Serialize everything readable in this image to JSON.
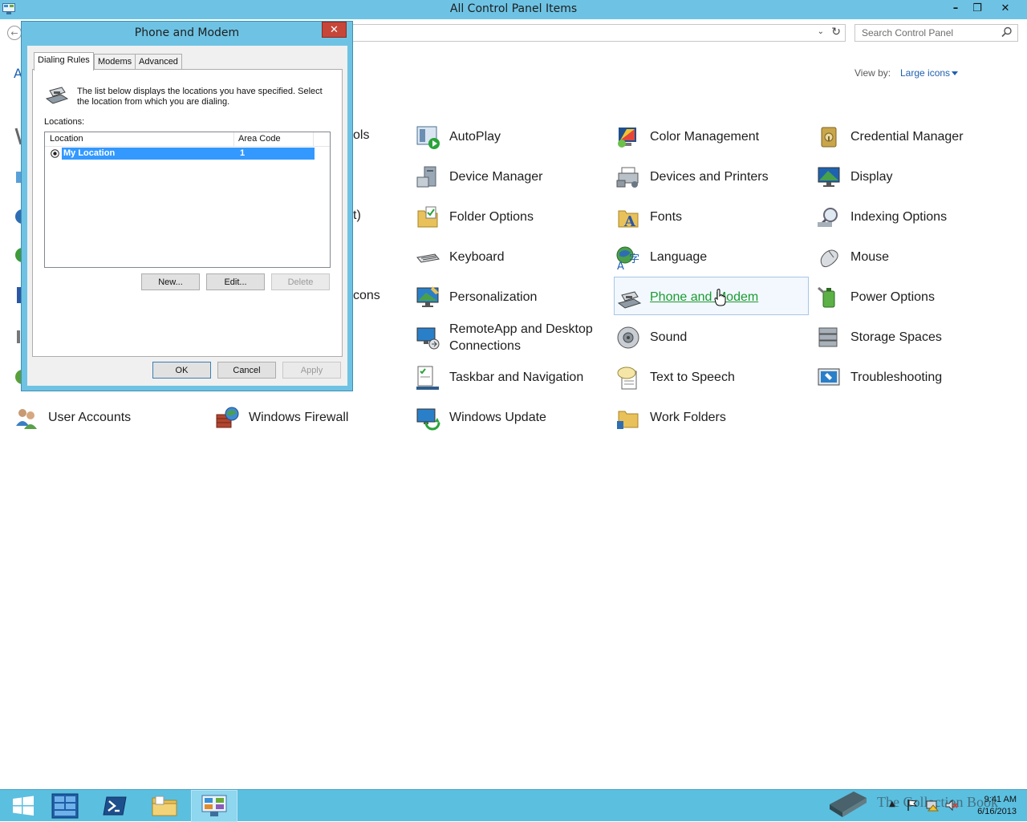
{
  "window": {
    "title": "All Control Panel Items",
    "minimize": "–",
    "restore": "❐",
    "close": "✕"
  },
  "address": {
    "search_placeholder": "Search Control Panel"
  },
  "view_by": {
    "label": "View by:",
    "value": "Large icons"
  },
  "heading_stub": "A",
  "partial_labels": {
    "row1": "ols",
    "row3": "t)",
    "row5": "cons"
  },
  "items": [
    {
      "label": "AutoPlay",
      "icon": "autoplay-icon"
    },
    {
      "label": "Color Management",
      "icon": "color-management-icon"
    },
    {
      "label": "Credential Manager",
      "icon": "credential-manager-icon"
    },
    {
      "label": "Device Manager",
      "icon": "device-manager-icon"
    },
    {
      "label": "Devices and Printers",
      "icon": "devices-printers-icon"
    },
    {
      "label": "Display",
      "icon": "display-icon"
    },
    {
      "label": "Folder Options",
      "icon": "folder-options-icon"
    },
    {
      "label": "Fonts",
      "icon": "fonts-icon"
    },
    {
      "label": "Indexing Options",
      "icon": "indexing-options-icon"
    },
    {
      "label": "Keyboard",
      "icon": "keyboard-icon"
    },
    {
      "label": "Language",
      "icon": "language-icon"
    },
    {
      "label": "Mouse",
      "icon": "mouse-icon"
    },
    {
      "label": "Personalization",
      "icon": "personalization-icon"
    },
    {
      "label": "Phone and Modem",
      "icon": "phone-modem-icon"
    },
    {
      "label": "Power Options",
      "icon": "power-options-icon"
    },
    {
      "label": "RemoteApp and Desktop Connections",
      "icon": "remoteapp-icon"
    },
    {
      "label": "Sound",
      "icon": "sound-icon"
    },
    {
      "label": "Storage Spaces",
      "icon": "storage-spaces-icon"
    },
    {
      "label": "Taskbar and Navigation",
      "icon": "taskbar-navigation-icon"
    },
    {
      "label": "Text to Speech",
      "icon": "text-to-speech-icon"
    },
    {
      "label": "Troubleshooting",
      "icon": "troubleshooting-icon"
    },
    {
      "label": "User Accounts",
      "icon": "user-accounts-icon"
    },
    {
      "label": "Windows Firewall",
      "icon": "windows-firewall-icon"
    },
    {
      "label": "Windows Update",
      "icon": "windows-update-icon"
    },
    {
      "label": "Work Folders",
      "icon": "work-folders-icon"
    }
  ],
  "dialog": {
    "title": "Phone and Modem",
    "close": "✕",
    "tabs": [
      "Dialing Rules",
      "Modems",
      "Advanced"
    ],
    "description": "The list below displays the locations you have specified. Select the location from which you are dialing.",
    "locations_label": "Locations:",
    "columns": [
      "Location",
      "Area Code"
    ],
    "rows": [
      {
        "location": "My Location",
        "area_code": "1"
      }
    ],
    "buttons": {
      "new": "New...",
      "edit": "Edit...",
      "delete": "Delete",
      "ok": "OK",
      "cancel": "Cancel",
      "apply": "Apply"
    }
  },
  "taskbar": {
    "time": "9:41 AM",
    "date": "6/16/2013",
    "watermark": "The Collection Book"
  },
  "colors": {
    "titlebar": "#6ec3e4",
    "taskbar": "#5bbfe0",
    "link": "#1e5fb0",
    "selected_link": "#1b9b32",
    "selection": "#3399ff"
  }
}
